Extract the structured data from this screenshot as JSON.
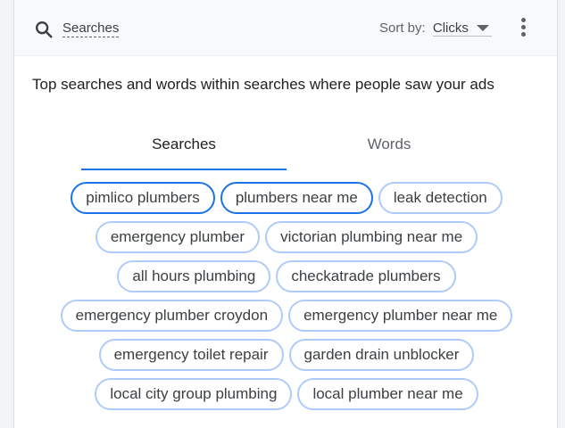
{
  "header": {
    "search_label": "Searches",
    "sort_prefix": "Sort by:",
    "sort_value": "Clicks"
  },
  "description": "Top searches and words within searches where people saw your ads",
  "tabs": [
    {
      "label": "Searches",
      "active": true
    },
    {
      "label": "Words",
      "active": false
    }
  ],
  "chips": [
    [
      {
        "label": "pimlico plumbers",
        "selected": true
      },
      {
        "label": "plumbers near me",
        "selected": true
      },
      {
        "label": "leak detection",
        "selected": false
      }
    ],
    [
      {
        "label": "emergency plumber",
        "selected": false
      },
      {
        "label": "victorian plumbing near me",
        "selected": false
      }
    ],
    [
      {
        "label": "all hours plumbing",
        "selected": false
      },
      {
        "label": "checkatrade plumbers",
        "selected": false
      }
    ],
    [
      {
        "label": "emergency plumber croydon",
        "selected": false
      },
      {
        "label": "emergency plumber near me",
        "selected": false
      }
    ],
    [
      {
        "label": "emergency toilet repair",
        "selected": false
      },
      {
        "label": "garden drain unblocker",
        "selected": false
      }
    ],
    [
      {
        "label": "local city group plumbing",
        "selected": false
      },
      {
        "label": "local plumber near me",
        "selected": false
      }
    ]
  ],
  "colors": {
    "accent": "#1a73e8",
    "chip_border": "#aecbfa"
  }
}
